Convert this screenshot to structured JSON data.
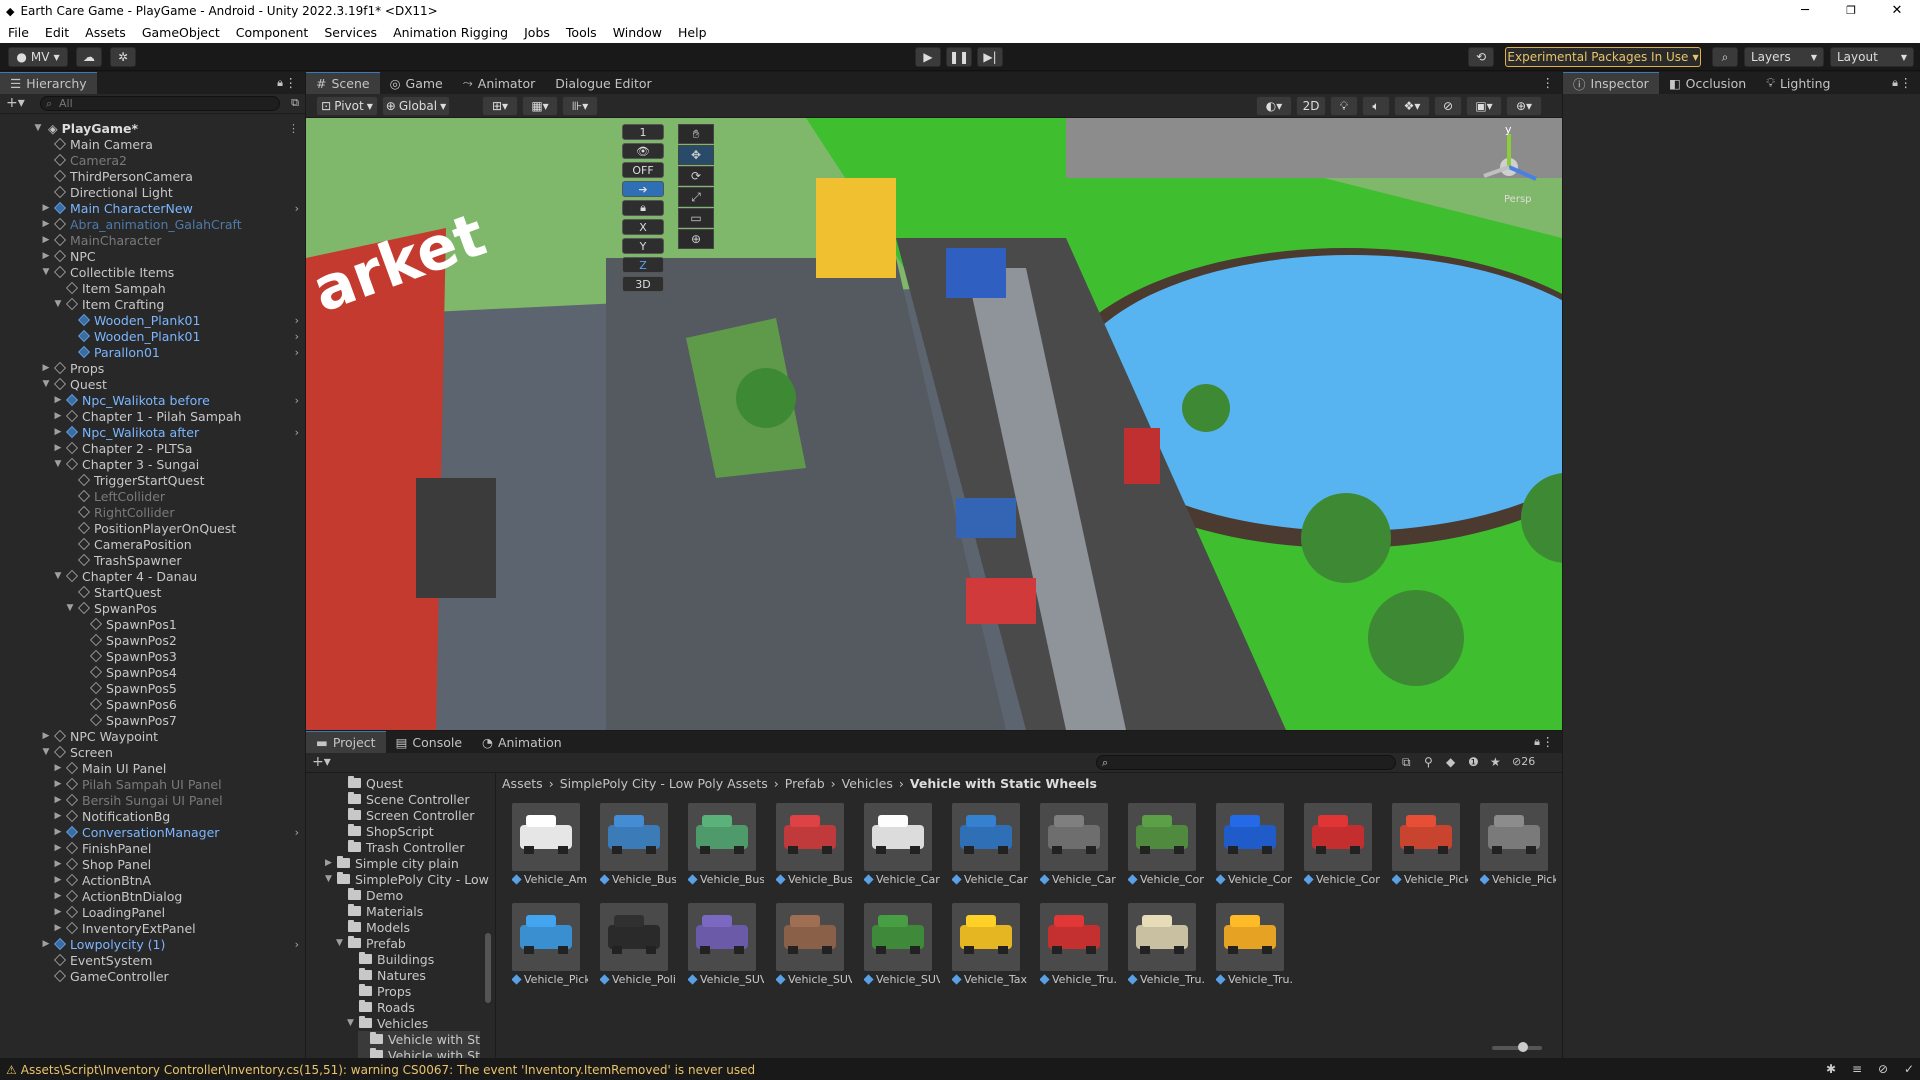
{
  "window": {
    "title": "Earth Care Game - PlayGame - Android - Unity 2022.3.19f1* <DX11>",
    "minimize": "─",
    "maximize": "❐",
    "close": "✕"
  },
  "menu": [
    "File",
    "Edit",
    "Assets",
    "GameObject",
    "Component",
    "Services",
    "Animation Rigging",
    "Jobs",
    "Tools",
    "Window",
    "Help"
  ],
  "toolbar": {
    "account": "MV",
    "experimental": "Experimental Packages In Use",
    "layers": "Layers",
    "layout": "Layout"
  },
  "hierarchy": {
    "tab": "Hierarchy",
    "search_placeholder": "All",
    "scene": "PlayGame*",
    "rows": [
      {
        "label": "Main Camera",
        "depth": 1,
        "arrow": "",
        "style": ""
      },
      {
        "label": "Camera2",
        "depth": 1,
        "arrow": "",
        "style": "dim"
      },
      {
        "label": "ThirdPersonCamera",
        "depth": 1,
        "arrow": "",
        "style": ""
      },
      {
        "label": "Directional Light",
        "depth": 1,
        "arrow": "",
        "style": ""
      },
      {
        "label": "Main CharacterNew",
        "depth": 1,
        "arrow": "▶",
        "style": "blue"
      },
      {
        "label": "Abra_animation_GalahCraft",
        "depth": 1,
        "arrow": "▶",
        "style": "dimblue"
      },
      {
        "label": "MainCharacter",
        "depth": 1,
        "arrow": "▶",
        "style": "dim"
      },
      {
        "label": "NPC",
        "depth": 1,
        "arrow": "▶",
        "style": ""
      },
      {
        "label": "Collectible Items",
        "depth": 1,
        "arrow": "▼",
        "style": ""
      },
      {
        "label": "Item Sampah",
        "depth": 2,
        "arrow": "",
        "style": ""
      },
      {
        "label": "Item Crafting",
        "depth": 2,
        "arrow": "▼",
        "style": ""
      },
      {
        "label": "Wooden_Plank01",
        "depth": 3,
        "arrow": "",
        "style": "blue"
      },
      {
        "label": "Wooden_Plank01",
        "depth": 3,
        "arrow": "",
        "style": "blue"
      },
      {
        "label": "Parallon01",
        "depth": 3,
        "arrow": "",
        "style": "blue"
      },
      {
        "label": "Props",
        "depth": 1,
        "arrow": "▶",
        "style": ""
      },
      {
        "label": "Quest",
        "depth": 1,
        "arrow": "▼",
        "style": ""
      },
      {
        "label": "Npc_Walikota before",
        "depth": 2,
        "arrow": "▶",
        "style": "blue"
      },
      {
        "label": "Chapter 1 - Pilah Sampah",
        "depth": 2,
        "arrow": "▶",
        "style": ""
      },
      {
        "label": "Npc_Walikota after",
        "depth": 2,
        "arrow": "▶",
        "style": "blue"
      },
      {
        "label": "Chapter 2 - PLTSa",
        "depth": 2,
        "arrow": "▶",
        "style": ""
      },
      {
        "label": "Chapter 3 - Sungai",
        "depth": 2,
        "arrow": "▼",
        "style": ""
      },
      {
        "label": "TriggerStartQuest",
        "depth": 3,
        "arrow": "",
        "style": ""
      },
      {
        "label": "LeftCollider",
        "depth": 3,
        "arrow": "",
        "style": "dim"
      },
      {
        "label": "RightCollider",
        "depth": 3,
        "arrow": "",
        "style": "dim"
      },
      {
        "label": "PositionPlayerOnQuest",
        "depth": 3,
        "arrow": "",
        "style": ""
      },
      {
        "label": "CameraPosition",
        "depth": 3,
        "arrow": "",
        "style": ""
      },
      {
        "label": "TrashSpawner",
        "depth": 3,
        "arrow": "",
        "style": ""
      },
      {
        "label": "Chapter 4 - Danau",
        "depth": 2,
        "arrow": "▼",
        "style": ""
      },
      {
        "label": "StartQuest",
        "depth": 3,
        "arrow": "",
        "style": ""
      },
      {
        "label": "SpwanPos",
        "depth": 3,
        "arrow": "▼",
        "style": ""
      },
      {
        "label": "SpawnPos1",
        "depth": 4,
        "arrow": "",
        "style": ""
      },
      {
        "label": "SpawnPos2",
        "depth": 4,
        "arrow": "",
        "style": ""
      },
      {
        "label": "SpawnPos3",
        "depth": 4,
        "arrow": "",
        "style": ""
      },
      {
        "label": "SpawnPos4",
        "depth": 4,
        "arrow": "",
        "style": ""
      },
      {
        "label": "SpawnPos5",
        "depth": 4,
        "arrow": "",
        "style": ""
      },
      {
        "label": "SpawnPos6",
        "depth": 4,
        "arrow": "",
        "style": ""
      },
      {
        "label": "SpawnPos7",
        "depth": 4,
        "arrow": "",
        "style": ""
      },
      {
        "label": "NPC Waypoint",
        "depth": 1,
        "arrow": "▶",
        "style": ""
      },
      {
        "label": "Screen",
        "depth": 1,
        "arrow": "▼",
        "style": ""
      },
      {
        "label": "Main UI Panel",
        "depth": 2,
        "arrow": "▶",
        "style": ""
      },
      {
        "label": "Pilah Sampah UI Panel",
        "depth": 2,
        "arrow": "▶",
        "style": "dim"
      },
      {
        "label": "Bersih Sungai UI Panel",
        "depth": 2,
        "arrow": "▶",
        "style": "dim"
      },
      {
        "label": "NotificationBg",
        "depth": 2,
        "arrow": "▶",
        "style": ""
      },
      {
        "label": "ConversationManager",
        "depth": 2,
        "arrow": "▶",
        "style": "blue"
      },
      {
        "label": "FinishPanel",
        "depth": 2,
        "arrow": "▶",
        "style": ""
      },
      {
        "label": "Shop Panel",
        "depth": 2,
        "arrow": "▶",
        "style": ""
      },
      {
        "label": "ActionBtnA",
        "depth": 2,
        "arrow": "▶",
        "style": ""
      },
      {
        "label": "ActionBtnDialog",
        "depth": 2,
        "arrow": "▶",
        "style": ""
      },
      {
        "label": "LoadingPanel",
        "depth": 2,
        "arrow": "▶",
        "style": ""
      },
      {
        "label": "InventoryExtPanel",
        "depth": 2,
        "arrow": "▶",
        "style": ""
      },
      {
        "label": "Lowpolycity (1)",
        "depth": 1,
        "arrow": "▶",
        "style": "blue"
      },
      {
        "label": "EventSystem",
        "depth": 1,
        "arrow": "",
        "style": ""
      },
      {
        "label": "GameController",
        "depth": 1,
        "arrow": "",
        "style": ""
      }
    ]
  },
  "scene_tabs": [
    "Scene",
    "Game",
    "Animator",
    "Dialogue Editor"
  ],
  "scene_toolbar": {
    "pivot": "Pivot",
    "global": "Global",
    "mode_2d": "2D"
  },
  "scene_overlay": [
    "1",
    "",
    "OFF",
    "",
    "",
    "X",
    "Y",
    "Z",
    "3D"
  ],
  "scene_billboard": "arket",
  "gizmo_label": "Persp",
  "inspector_tabs": [
    "Inspector",
    "Occlusion",
    "Lighting"
  ],
  "bottom_tabs": [
    "Project",
    "Console",
    "Animation"
  ],
  "project": {
    "folders": [
      {
        "label": "Quest",
        "depth": 2,
        "arrow": ""
      },
      {
        "label": "Scene Controller",
        "depth": 2,
        "arrow": ""
      },
      {
        "label": "Screen Controller",
        "depth": 2,
        "arrow": ""
      },
      {
        "label": "ShopScript",
        "depth": 2,
        "arrow": ""
      },
      {
        "label": "Trash Controller",
        "depth": 2,
        "arrow": ""
      },
      {
        "label": "Simple city plain",
        "depth": 1,
        "arrow": "▶"
      },
      {
        "label": "SimplePoly City - Low",
        "depth": 1,
        "arrow": "▼"
      },
      {
        "label": "Demo",
        "depth": 2,
        "arrow": ""
      },
      {
        "label": "Materials",
        "depth": 2,
        "arrow": ""
      },
      {
        "label": "Models",
        "depth": 2,
        "arrow": ""
      },
      {
        "label": "Prefab",
        "depth": 2,
        "arrow": "▼"
      },
      {
        "label": "Buildings",
        "depth": 3,
        "arrow": ""
      },
      {
        "label": "Natures",
        "depth": 3,
        "arrow": ""
      },
      {
        "label": "Props",
        "depth": 3,
        "arrow": ""
      },
      {
        "label": "Roads",
        "depth": 3,
        "arrow": ""
      },
      {
        "label": "Vehicles",
        "depth": 3,
        "arrow": "▼"
      },
      {
        "label": "Vehicle with St",
        "depth": 4,
        "arrow": ""
      },
      {
        "label": "Vehicle with St",
        "depth": 4,
        "arrow": ""
      }
    ],
    "breadcrumb": [
      "Assets",
      "SimplePoly City - Low Poly Assets",
      "Prefab",
      "Vehicles",
      "Vehicle with Static Wheels"
    ],
    "hidden_count": "26",
    "assets": [
      {
        "label": "Vehicle_Am…",
        "color": "#e6e6e6"
      },
      {
        "label": "Vehicle_Bus…",
        "color": "#3b7bb8"
      },
      {
        "label": "Vehicle_Bus…",
        "color": "#4e9a6a"
      },
      {
        "label": "Vehicle_Bus…",
        "color": "#c0393b"
      },
      {
        "label": "Vehicle_Car…",
        "color": "#dcdcdc"
      },
      {
        "label": "Vehicle_Car…",
        "color": "#2f6fb5"
      },
      {
        "label": "Vehicle_Car…",
        "color": "#6e6e6e"
      },
      {
        "label": "Vehicle_Con…",
        "color": "#4f8a3e"
      },
      {
        "label": "Vehicle_Con…",
        "color": "#1f5cc9"
      },
      {
        "label": "Vehicle_Con…",
        "color": "#c42e2e"
      },
      {
        "label": "Vehicle_Pick…",
        "color": "#c8442e"
      },
      {
        "label": "Vehicle_Pick…",
        "color": "#7a7a7a"
      },
      {
        "label": "Vehicle_Pick…",
        "color": "#3a8fd0"
      },
      {
        "label": "Vehicle_Poli…",
        "color": "#2a2a2a"
      },
      {
        "label": "Vehicle_SUV…",
        "color": "#6a5aa8"
      },
      {
        "label": "Vehicle_SUV…",
        "color": "#8a6048"
      },
      {
        "label": "Vehicle_SUV…",
        "color": "#3f8a3a"
      },
      {
        "label": "Vehicle_Taxi",
        "color": "#e6b622"
      },
      {
        "label": "Vehicle_Tru…",
        "color": "#c43030"
      },
      {
        "label": "Vehicle_Tru…",
        "color": "#c8c0a0"
      },
      {
        "label": "Vehicle_Tru…",
        "color": "#e6a222"
      }
    ]
  },
  "status": {
    "message": "Assets\\Script\\Inventory Controller\\Inventory.cs(15,51): warning CS0067: The event 'Inventory.ItemRemoved' is never used"
  },
  "colors": {
    "accent": "#3a79bb",
    "selection": "#2c5d87",
    "warning": "#e8c46a",
    "experimental_border": "#e0b040"
  }
}
